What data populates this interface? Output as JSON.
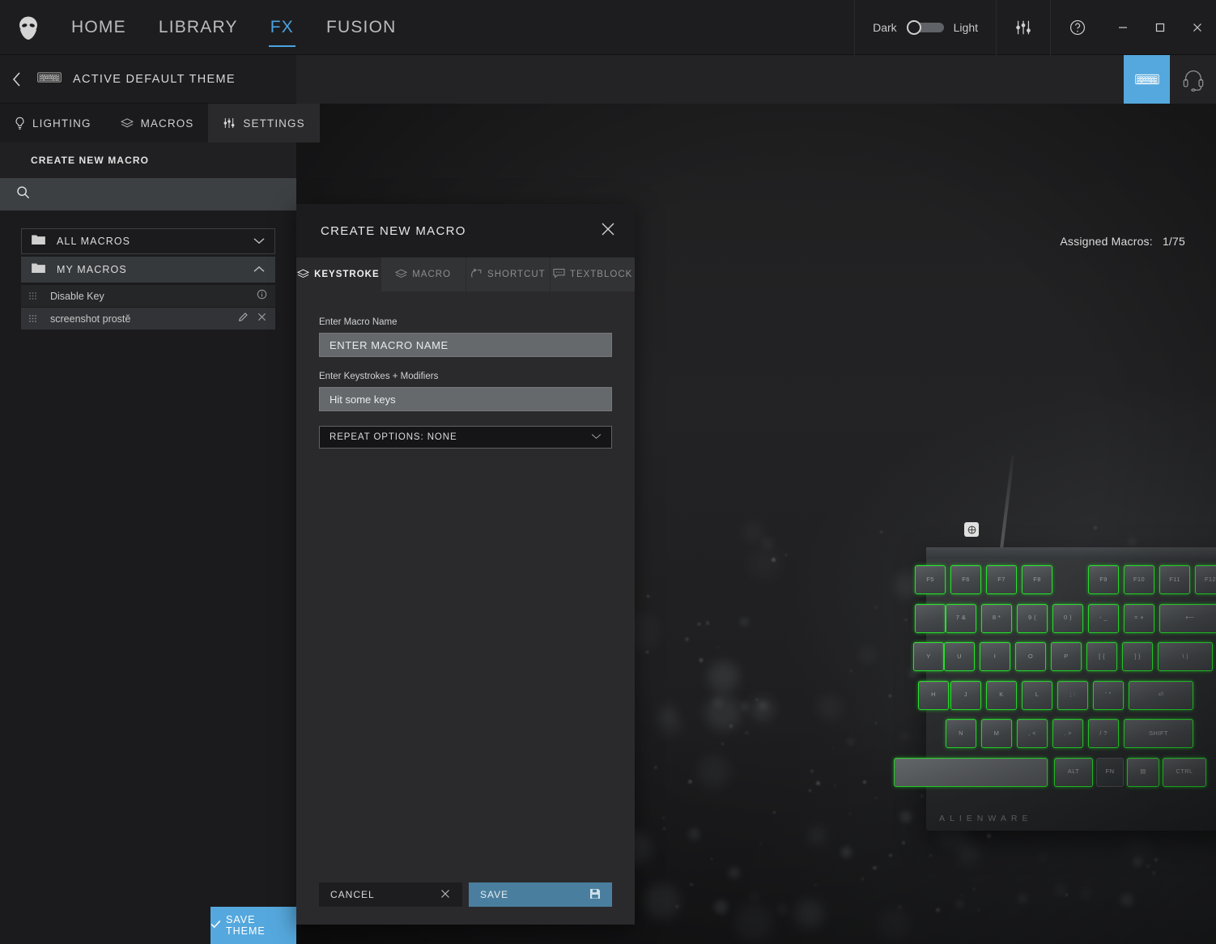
{
  "topbar": {
    "logo_icon": "alienware-head-icon",
    "nav": [
      {
        "label": "HOME",
        "active": false
      },
      {
        "label": "LIBRARY",
        "active": false
      },
      {
        "label": "FX",
        "active": true
      },
      {
        "label": "FUSION",
        "active": false
      }
    ],
    "theme_toggle": {
      "left_label": "Dark",
      "right_label": "Light",
      "selected": "Dark"
    },
    "settings_icon": "sliders-icon",
    "help_icon": "question-circle-icon",
    "window_controls": {
      "minimize": "minimize-icon",
      "maximize": "maximize-icon",
      "close": "close-icon"
    }
  },
  "device_bar": {
    "devices": [
      {
        "icon": "keyboard-icon",
        "selected": true
      },
      {
        "icon": "headset-icon",
        "selected": false
      }
    ]
  },
  "sidebar": {
    "back_icon": "chevron-left-icon",
    "theme_device_icon": "keyboard-icon",
    "theme_title": "ACTIVE DEFAULT THEME",
    "tabs": [
      {
        "label": "LIGHTING",
        "icon": "bulb-icon",
        "active": true
      },
      {
        "label": "MACROS",
        "icon": "layers-icon",
        "active": false
      },
      {
        "label": "SETTINGS",
        "icon": "sliders-icon",
        "active": false
      }
    ],
    "create_new_macro_label": "CREATE NEW MACRO",
    "search": {
      "icon": "search-icon",
      "value": "",
      "placeholder": ""
    },
    "folders": [
      {
        "name": "ALL MACROS",
        "icon": "folder-icon",
        "expanded": false,
        "chevron": "chevron-down-icon"
      },
      {
        "name": "MY MACROS",
        "icon": "folder-icon",
        "expanded": true,
        "chevron": "chevron-up-icon"
      }
    ],
    "macros": [
      {
        "name": "Disable Key",
        "grip": "grip-icon",
        "actions": [
          "info-icon"
        ]
      },
      {
        "name": "screenshot prostě",
        "grip": "grip-icon",
        "actions": [
          "pencil-icon",
          "close-icon"
        ]
      }
    ],
    "save_theme_label": "SAVE THEME",
    "save_theme_icon": "check-icon"
  },
  "stage": {
    "assigned_macros_label": "Assigned Macros:",
    "assigned_macros_value": "1/75",
    "keyboard_brand": "ALIENWARE"
  },
  "modal": {
    "title": "CREATE NEW MACRO",
    "close_icon": "close-icon",
    "tabs": [
      {
        "label": "KEYSTROKE",
        "icon": "layers-icon",
        "active": true
      },
      {
        "label": "MACRO",
        "icon": "layers-icon",
        "active": false
      },
      {
        "label": "SHORTCUT",
        "icon": "shortcut-icon",
        "active": false
      },
      {
        "label": "TEXTBLOCK",
        "icon": "textblock-icon",
        "active": false
      }
    ],
    "name_label": "Enter Macro Name",
    "name_value": "",
    "name_placeholder": "ENTER MACRO NAME",
    "keys_label": "Enter Keystrokes + Modifiers",
    "keys_value": "",
    "keys_placeholder": "Hit some keys",
    "repeat_label": "REPEAT OPTIONS: NONE",
    "repeat_chevron": "chevron-down-icon",
    "cancel_label": "CANCEL",
    "cancel_icon": "close-icon",
    "save_label": "SAVE",
    "save_icon": "floppy-icon"
  },
  "colors": {
    "accent": "#55a8dd",
    "accent_fx": "#4aa3e0",
    "save_button": "#4a7e9e",
    "key_glow": "#26e02a",
    "panel": "#2a2a2c",
    "sidebar": "#1b1b1d",
    "topbar": "#1d1d1f"
  }
}
